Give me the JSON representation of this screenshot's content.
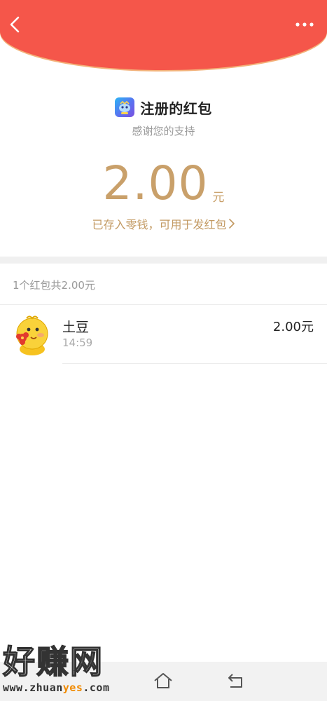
{
  "header": {
    "back_icon": "chevron-left-icon",
    "more_icon": "more-dots-icon",
    "color": "#f5564a"
  },
  "sender": {
    "name": "注册的红包",
    "subtitle": "感谢您的支持",
    "icon": "app-icon"
  },
  "amount": {
    "value": "2.00",
    "unit": "元",
    "color": "#c9a06a"
  },
  "stored_link": {
    "label": "已存入零钱，可用于发红包",
    "icon": "chevron-right-icon"
  },
  "summary": "1个红包共2.00元",
  "receivers": [
    {
      "name": "土豆",
      "time": "14:59",
      "amount": "2.00元",
      "avatar": "cartoon-avatar-icon"
    }
  ],
  "navbar": {
    "home_icon": "home-icon",
    "back_icon": "back-arrow-icon"
  },
  "watermark": {
    "title": "好赚网",
    "url_prefix": "www.zhuan",
    "url_highlight": "yes",
    "url_suffix": ".com"
  }
}
